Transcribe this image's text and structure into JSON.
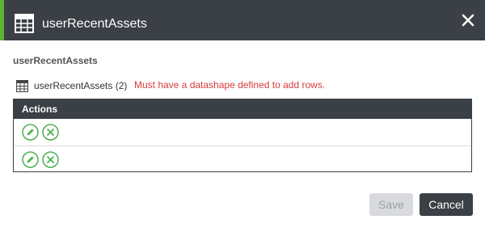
{
  "dialog": {
    "title": "userRecentAssets",
    "title_icon": "table-icon",
    "close_icon": "close-icon"
  },
  "content": {
    "section_label": "userRecentAssets",
    "infotable_name": "userRecentAssets (2)",
    "error_message": "Must have a datashape defined to add rows."
  },
  "grid": {
    "header": "Actions",
    "rows": [
      {
        "edit_icon": "edit-icon",
        "delete_icon": "delete-icon"
      },
      {
        "edit_icon": "edit-icon",
        "delete_icon": "delete-icon"
      }
    ]
  },
  "footer": {
    "save_label": "Save",
    "cancel_label": "Cancel"
  },
  "colors": {
    "header_bg": "#3a4045",
    "accent": "#5cb531",
    "error": "#d63b3b",
    "action_icon": "#4caf50"
  }
}
